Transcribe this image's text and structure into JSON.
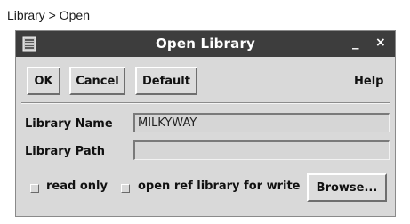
{
  "caption": "Library > Open",
  "window": {
    "title": "Open Library",
    "minimize_glyph": "_",
    "close_glyph": "×"
  },
  "toolbar": {
    "ok_label": "OK",
    "cancel_label": "Cancel",
    "default_label": "Default",
    "help_label": "Help"
  },
  "form": {
    "library_name_label": "Library Name",
    "library_name_value": "MILKYWAY",
    "library_path_label": "Library Path",
    "library_path_value": ""
  },
  "options": {
    "read_only_label": "read only",
    "read_only_checked": false,
    "open_ref_label": "open ref library for write",
    "open_ref_checked": false,
    "browse_label": "Browse..."
  },
  "icons": {
    "window_icon": "document-icon",
    "minimize_icon": "minimize-icon",
    "close_icon": "close-icon"
  },
  "colors": {
    "titlebar": "#3d3d3d",
    "dialog_bg": "#d9d9d9"
  }
}
